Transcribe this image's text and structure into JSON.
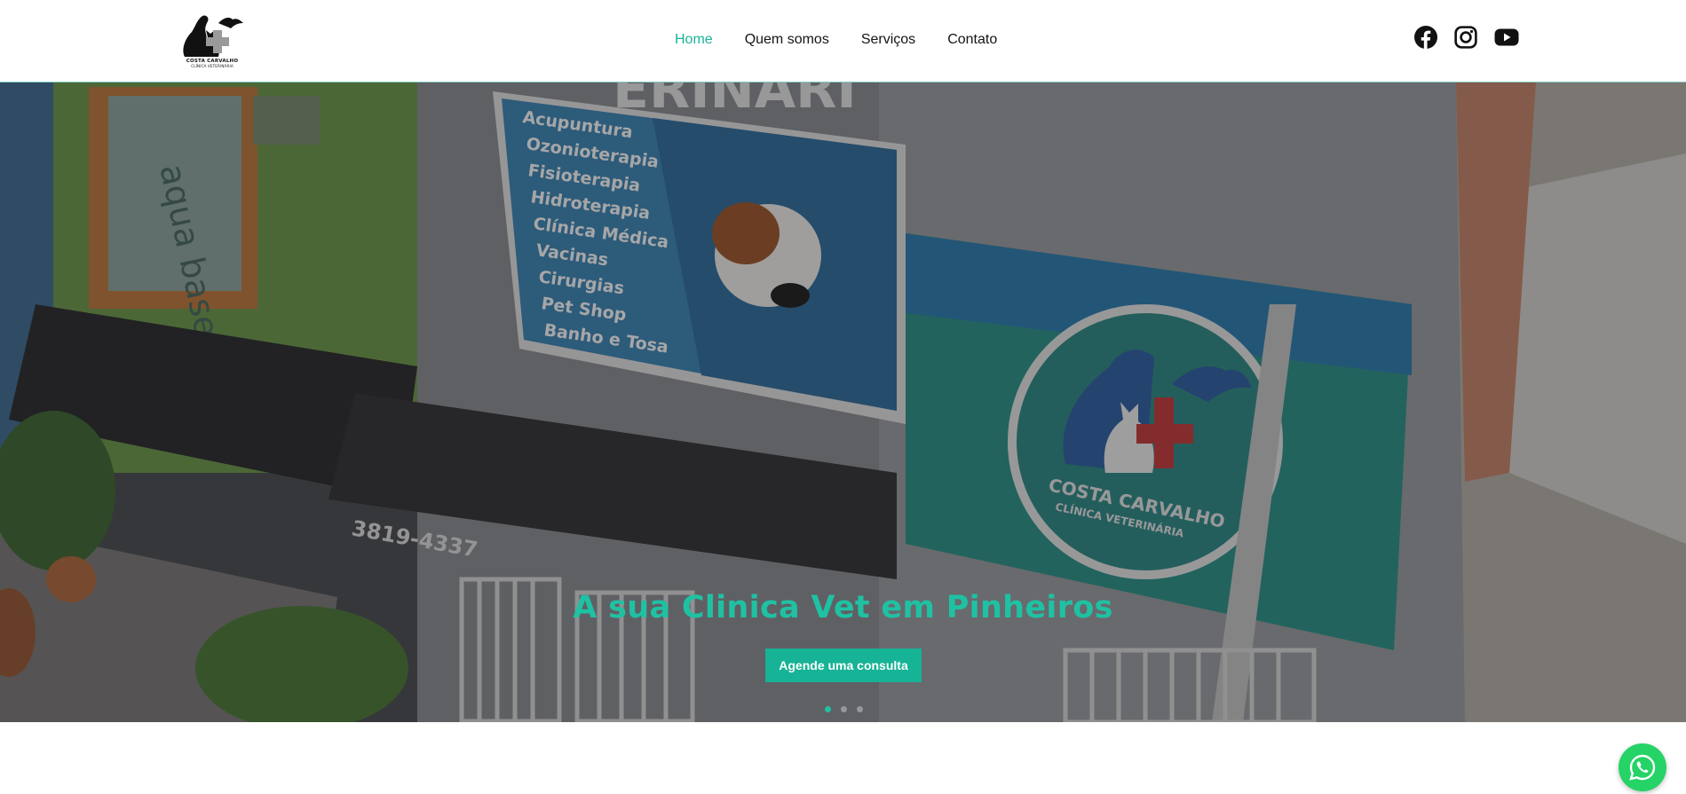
{
  "brand": {
    "logo_line1": "COSTA CARVALHO",
    "logo_line2": "CLÍNICA VETERINÁRIA",
    "logo_icon": "cat-dog-bird-cross-logo"
  },
  "nav": {
    "items": [
      {
        "label": "Home",
        "active": true
      },
      {
        "label": "Quem somos",
        "active": false
      },
      {
        "label": "Serviços",
        "active": false
      },
      {
        "label": "Contato",
        "active": false
      }
    ]
  },
  "social": {
    "icons": [
      "facebook-icon",
      "instagram-icon",
      "youtube-icon"
    ]
  },
  "hero": {
    "background_sign_top": "ERINARI",
    "services_sign": [
      "Acupuntura",
      "Ozonioterapia",
      "Fisioterapia",
      "Hidroterapia",
      "Clínica Médica",
      "Vacinas",
      "Cirurgias",
      "Pet Shop",
      "Banho e Tosa"
    ],
    "wall_sign": "aqua base",
    "phone": "3819-4337",
    "circle_sign_line1": "COSTA CARVALHO",
    "circle_sign_line2": "CLÍNICA VETERINÁRIA",
    "title": "A sua Clinica Vet em Pinheiros",
    "cta_label": "Agende uma consulta",
    "slides": 3,
    "active_slide": 1
  },
  "colors": {
    "accent": "#1ab39a",
    "title": "#1fc1a3",
    "whatsapp": "#25d366"
  },
  "floating": {
    "whatsapp_icon": "whatsapp-icon"
  }
}
